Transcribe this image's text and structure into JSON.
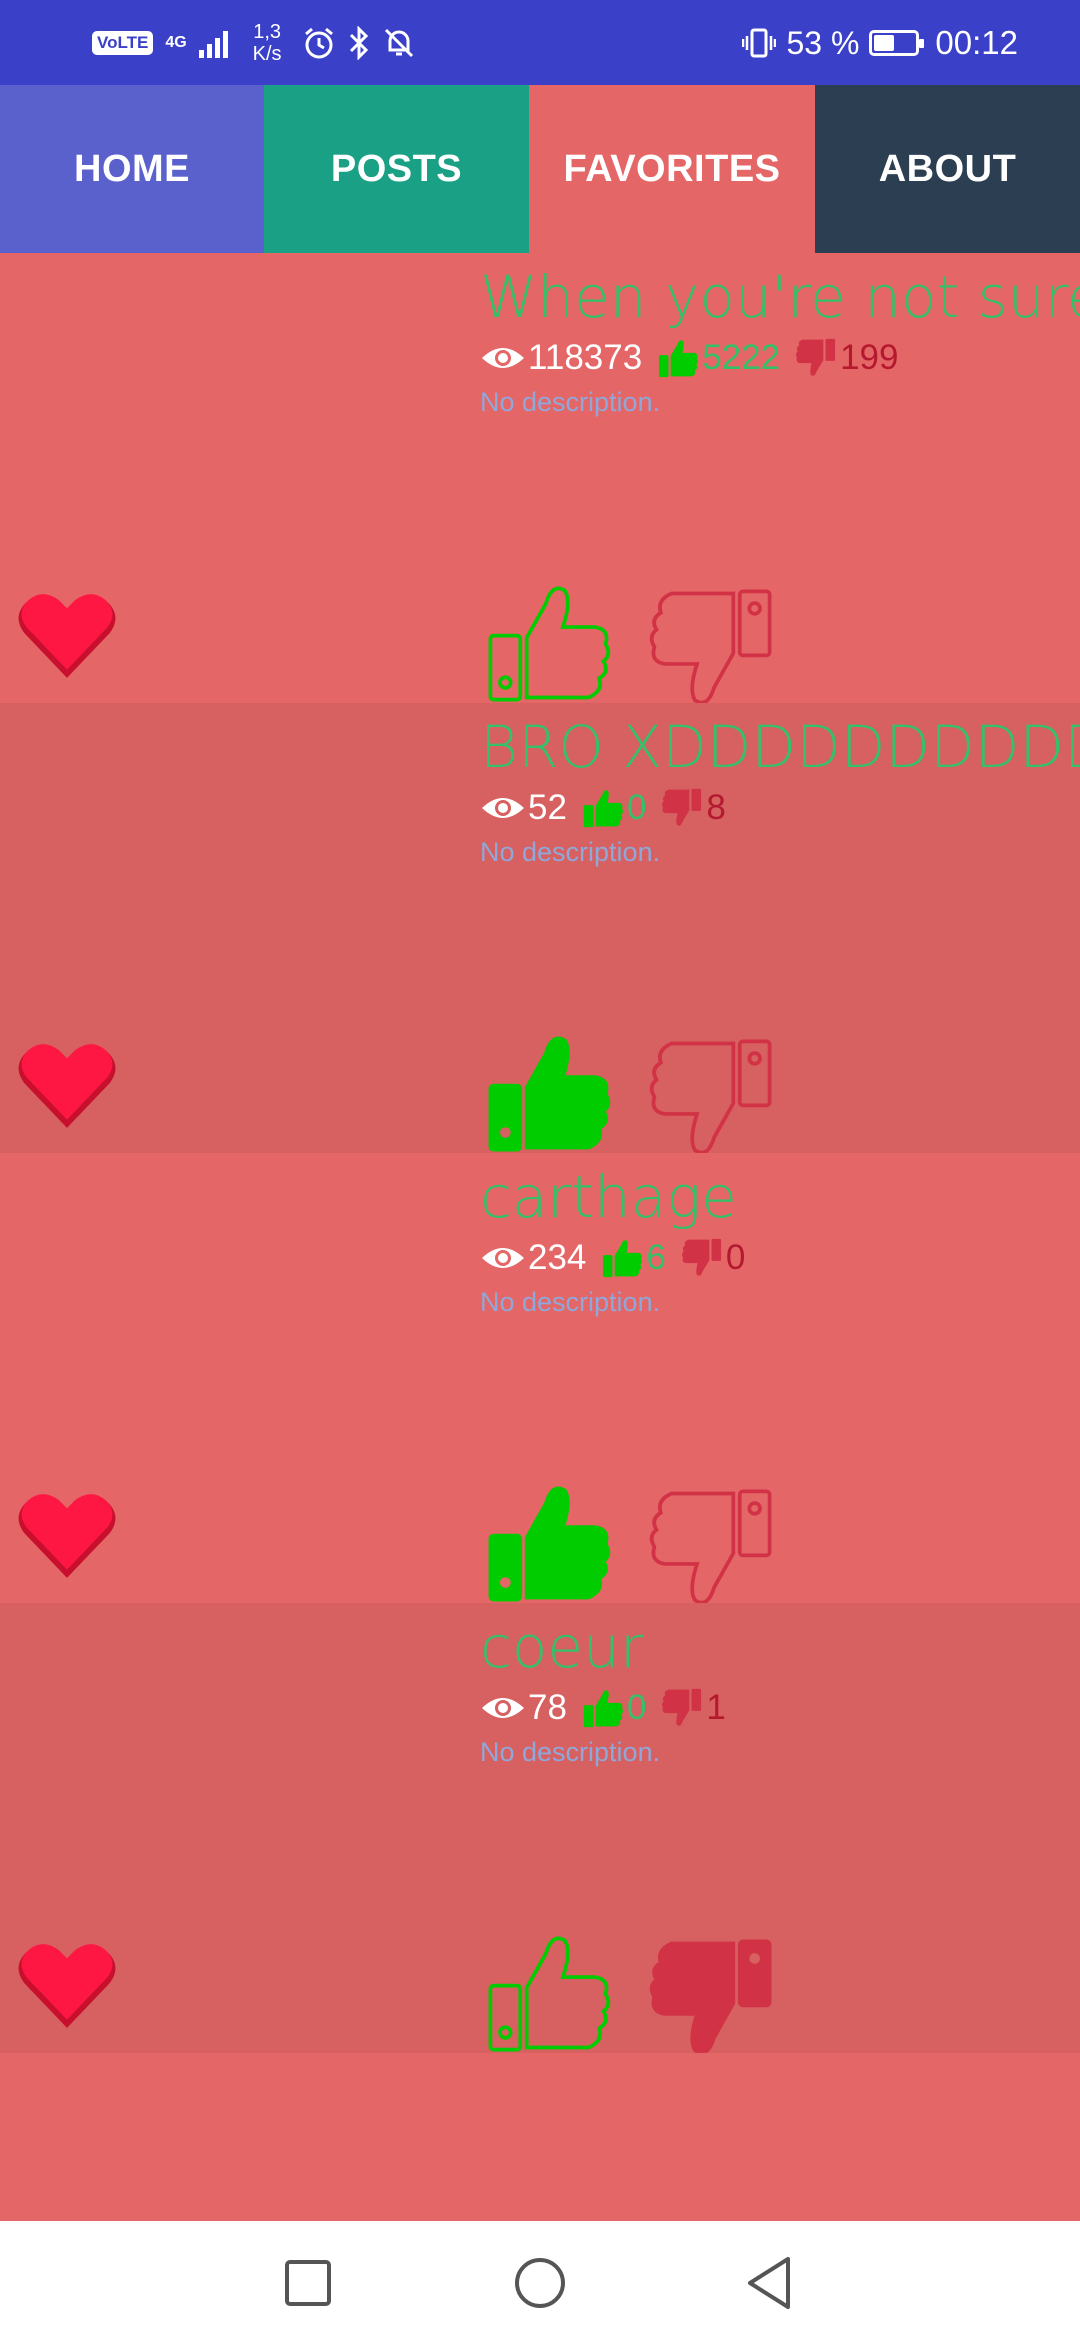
{
  "status_bar": {
    "volte": "VoLTE",
    "network": "4G",
    "speed_value": "1,3",
    "speed_unit": "K/s",
    "battery_percent": "53 %",
    "battery_level": 0.53,
    "time": "00:12",
    "icons": [
      "signal-icon",
      "alarm-icon",
      "bluetooth-icon",
      "notifications-off-icon",
      "vibrate-icon",
      "battery-charging-icon"
    ]
  },
  "tabs": [
    {
      "label": "HOME",
      "color": "#5a60cc"
    },
    {
      "label": "POSTS",
      "color": "#19a085"
    },
    {
      "label": "FAVORITES",
      "color": "#e56666",
      "selected": true
    },
    {
      "label": "ABOUT",
      "color": "#2c3e51"
    }
  ],
  "posts": [
    {
      "title": "When you're not sure",
      "views": "118373",
      "likes": "5222",
      "dislikes": "199",
      "description": "No description.",
      "favorited": true,
      "liked": false,
      "disliked": false
    },
    {
      "title": "BRO XDDDDDDDDDDDDDDDD",
      "views": "52",
      "likes": "0",
      "dislikes": "8",
      "description": "No description.",
      "favorited": true,
      "liked": true,
      "disliked": false
    },
    {
      "title": "carthage",
      "views": "234",
      "likes": "6",
      "dislikes": "0",
      "description": "No description.",
      "favorited": true,
      "liked": true,
      "disliked": false
    },
    {
      "title": "coeur",
      "views": "78",
      "likes": "0",
      "dislikes": "1",
      "description": "No description.",
      "favorited": true,
      "liked": false,
      "disliked": true
    }
  ],
  "colors": {
    "background": "#e56666",
    "alt_row": "#d76060",
    "title": "#33c16a",
    "like": "#00cc00",
    "dislike": "#d13245",
    "heart": "#ff1744",
    "status_bar": "#3b40c8"
  },
  "nav_bar": {
    "buttons": [
      "recents-square-icon",
      "home-circle-icon",
      "back-triangle-icon"
    ]
  }
}
